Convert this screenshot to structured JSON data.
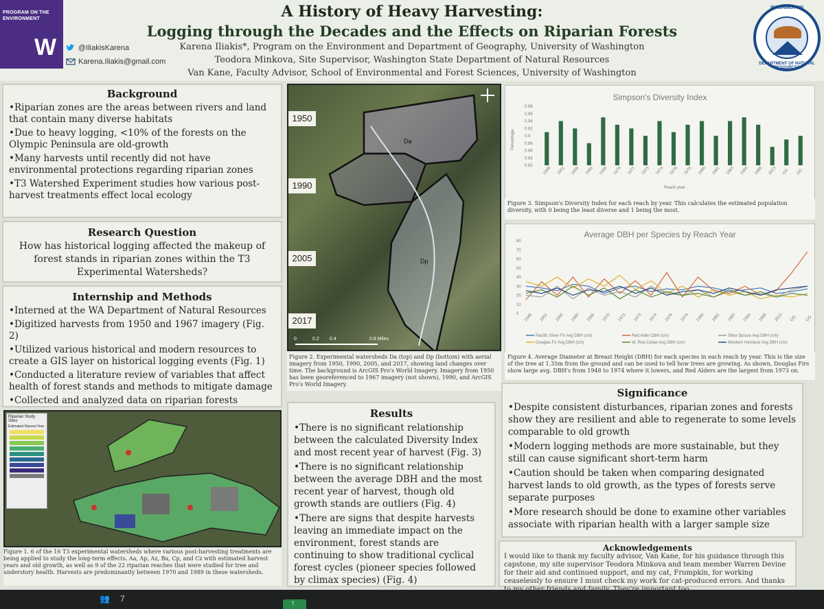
{
  "header": {
    "program_label_1": "PROGRAM ON THE",
    "program_label_2": "ENVIRONMENT",
    "logo_letter": "W",
    "twitter": "@IliakisKarena",
    "email": "Karena.Iliakis@gmail.com",
    "title": "A History of Heavy Harvesting:",
    "subtitle": "Logging through the Decades and the Effects on Riparian Forests",
    "author_line_1": "Karena Iliakis*, Program on the Environment and Department of Geography, University of Washington",
    "author_line_2": "Teodora Minkova, Site Supervisor, Washington State Department of Natural Resources",
    "author_line_3": "Van Kane, Faculty Advisor, School of Environmental and Forest Sciences, University of Washington",
    "seal_top": "WASHINGTON",
    "seal_bottom": "DEPARTMENT OF NATURAL RESOURCES"
  },
  "background": {
    "heading": "Background",
    "items": [
      "Riparian zones are the areas between rivers and land that contain many diverse habitats",
      "Due to heavy logging, <10% of the forests on the Olympic Peninsula are old-growth",
      "Many harvests until recently did not have environmental protections regarding riparian zones",
      "T3 Watershed Experiment studies how various post-harvest treatments effect local ecology"
    ]
  },
  "research_question": {
    "heading": "Research Question",
    "text": "How has historical logging affected the makeup of forest stands in riparian zones within the T3 Experimental Watersheds?"
  },
  "methods": {
    "heading": "Internship and Methods",
    "items": [
      "Interned at the WA Department of Natural Resources",
      "Digitized harvests from 1950 and 1967 imagery (Fig. 2)",
      "Utilized various historical and modern resources to create a GIS layer on historical logging events (Fig. 1)",
      "Conducted a literature review of variables that affect health of forest stands and methods to mitigate damage",
      "Collected and analyzed data on riparian forests"
    ]
  },
  "fig1": {
    "legend_title": "Riparian Study Sites",
    "legend_sub": "Estimated Harvest Year",
    "caption": "Figure 1. 6 of the 16 T3 experimental watersheds where various post-harvesting treatments are being applied to study the long-term effects. Aa, Ap, Az, Ba, Cp, and Cz with estimated harvest years and old growth, as well as 9 of the 22 riparian reaches that were studied for tree and understory health. Harvests are predominantly between 1970 and 1989 in these watersheds."
  },
  "fig2": {
    "years": [
      "1950",
      "1990",
      "2005",
      "2017"
    ],
    "label_top": "Da",
    "label_bottom": "Dp",
    "scale": [
      "0",
      "0.2",
      "0.4",
      "0.8 Miles"
    ],
    "caption": "Figure 2. Experimental watersheds Da (top) and Dp (bottom) with aerial imagery from 1950, 1990, 2005, and 2017, showing land changes over time. The background is ArcGIS Pro's World Imagery. Imagery from 1950 has been georeferenced to 1967 imagery (not shown), 1990, and ArcGIS Pro's World Imagery."
  },
  "results": {
    "heading": "Results",
    "items": [
      "There is no significant relationship between the calculated Diversity Index and most recent year of harvest (Fig. 3)",
      "There is no significant relationship between the average DBH and the most recent year of harvest, though old growth stands are outliers (Fig. 4)",
      "There are signs that despite harvests leaving an immediate impact on the environment, forest stands are continuing to show traditional cyclical forest cycles (pioneer species followed by climax species) (Fig. 4)"
    ]
  },
  "significance": {
    "heading": "Significance",
    "items": [
      "Despite consistent disturbances, riparian zones and forests show they are resilient and able to regenerate to some levels comparable to old growth",
      "Modern logging methods are more sustainable, but they still can cause significant short-term harm",
      "Caution should be taken when comparing designated harvest lands to old growth, as the types of forests serve separate purposes",
      "More research should be done to examine other variables associate with riparian health with a larger sample size"
    ]
  },
  "acknowledgements": {
    "heading": "Acknowledgements",
    "text": "I would like to thank my faculty advisor, Van Kane, for his guidance through this capstone, my site supervisor Teodora Minkova and team member Warren Devine for their aid and continued support, and my cat, Frumpkin, for working ceaselessly to ensure I must check my work for cat-produced errors. And thanks to my other friends and family. They're important too."
  },
  "fig3_caption": "Figure 3. Simpson's Diversity Index for each reach by year. This calculates the estimated population diversity, with 0 being the least diverse and 1 being the most.",
  "fig4_caption": "Figure 4. Average Diameter at Breast Height (DBH) for each species in each reach by year. This is the size of the tree at 1.35m from the ground and can be used to tell how trees are growing. As shown, Douglas Firs show large avg. DBH's from 1948 to 1974 where it lowers, and Red Alders are the largest from 1973 on.",
  "taskbar": {
    "participants": "7"
  },
  "chart_data": [
    {
      "type": "bar",
      "title": "Simpson's Diversity Index",
      "xlabel": "Reach year",
      "ylabel": "Percentage",
      "ylim": [
        0.82,
        0.98
      ],
      "yticks": [
        "0.98",
        "0.96",
        "0.94",
        "0.92",
        "0.9",
        "0.88",
        "0.86",
        "0.84",
        "0.82"
      ],
      "categories": [
        "1948",
        "1952",
        "1959",
        "1960",
        "1969",
        "1970",
        "1972",
        "1973",
        "1974",
        "1976",
        "1979",
        "1980",
        "1981",
        "1983",
        "1984",
        "1988",
        "2013",
        "OG",
        "OG"
      ],
      "values": [
        0.91,
        0.94,
        0.92,
        0.88,
        0.95,
        0.93,
        0.92,
        0.9,
        0.94,
        0.91,
        0.93,
        0.94,
        0.9,
        0.94,
        0.95,
        0.93,
        0.87,
        0.89,
        0.9
      ],
      "color": "#2f6b45"
    },
    {
      "type": "line",
      "title": "Average DBH per Species by Reach Year",
      "ylim": [
        0,
        80
      ],
      "yticks": [
        "80",
        "70",
        "60",
        "50",
        "40",
        "30",
        "20",
        "10",
        "0"
      ],
      "categories": [
        "1948",
        "1952",
        "1959",
        "1960",
        "1969",
        "1970",
        "1972",
        "1973",
        "1974",
        "1976",
        "1979",
        "1980",
        "1981",
        "1983",
        "1984",
        "1988",
        "2013",
        "OG",
        "OG"
      ],
      "series": [
        {
          "name": "Pacific Silver Fir Avg DBH (cm)",
          "color": "#4a78c0",
          "values": [
            30,
            28,
            25,
            32,
            30,
            22,
            28,
            30,
            24,
            27,
            26,
            30,
            28,
            24,
            26,
            28,
            22,
            24,
            27
          ]
        },
        {
          "name": "Red Alder DBH (cm)",
          "color": "#d36a3a",
          "values": [
            15,
            35,
            20,
            40,
            18,
            38,
            22,
            36,
            20,
            45,
            18,
            40,
            25,
            22,
            30,
            20,
            25,
            45,
            68
          ]
        },
        {
          "name": "Sitka Spruce Avg DBH (cm)",
          "color": "#a0a0a0",
          "values": [
            20,
            18,
            30,
            16,
            28,
            20,
            24,
            18,
            30,
            22,
            20,
            26,
            18,
            24,
            20,
            22,
            18,
            26,
            30
          ]
        },
        {
          "name": "Douglas Fir Avg DBH (cm)",
          "color": "#e0b030",
          "values": [
            35,
            30,
            40,
            28,
            38,
            30,
            42,
            26,
            36,
            22,
            30,
            18,
            26,
            20,
            24,
            16,
            20,
            18,
            22
          ]
        },
        {
          "name": "W. Red Cedar Avg DBH (cm)",
          "color": "#5a8a3a",
          "values": [
            22,
            26,
            18,
            30,
            20,
            28,
            16,
            26,
            18,
            24,
            20,
            22,
            18,
            26,
            20,
            24,
            18,
            22,
            20
          ]
        },
        {
          "name": "Western Hemlock Avg DBH (cm)",
          "color": "#2a4a80",
          "values": [
            25,
            22,
            28,
            20,
            26,
            24,
            30,
            22,
            28,
            20,
            24,
            26,
            22,
            28,
            24,
            20,
            26,
            28,
            30
          ]
        }
      ]
    }
  ]
}
